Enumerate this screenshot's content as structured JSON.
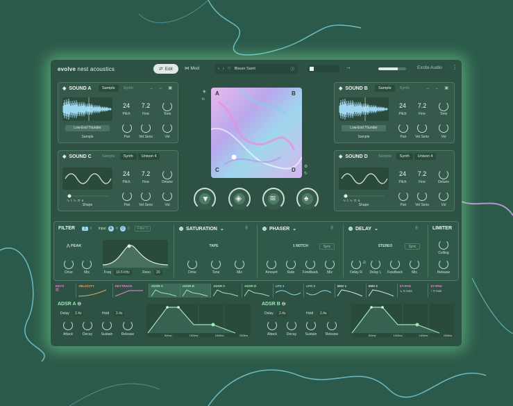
{
  "header": {
    "brand_bold": "evolve",
    "brand_rest": "nest acoustics",
    "edit_label": "Edit",
    "mod_label": "Mod",
    "preset_name": "Blauer Samt",
    "company": "Excite Audio"
  },
  "sound_a": {
    "title": "SOUND A",
    "tab1": "Sample",
    "tab2": "Synth",
    "pitch_value": "24",
    "fine_value": "7.2",
    "pitch_label": "Pitch",
    "fine_label": "Fine",
    "tone_label": "Tone",
    "sample_name": "Low-End Thunder",
    "sample_label": "Sample",
    "pan_label": "Pan",
    "velsens_label": "Vel Sens",
    "vol_label": "Vol"
  },
  "sound_b": {
    "title": "SOUND B",
    "tab1": "Sample",
    "tab2": "Synth",
    "pitch_value": "24",
    "fine_value": "7.2",
    "pitch_label": "Pitch",
    "fine_label": "Fine",
    "tone_label": "Tone",
    "sample_name": "Low-End Thunder",
    "sample_label": "Sample",
    "pan_label": "Pan",
    "velsens_label": "Vel Sens",
    "vol_label": "Vol"
  },
  "sound_c": {
    "title": "SOUND C",
    "tab1": "Sample",
    "tab2": "Synth",
    "unison_label": "Unison",
    "unison_value": "4",
    "pitch_value": "24",
    "fine_value": "7.2",
    "pitch_label": "Pitch",
    "fine_label": "Fine",
    "detune_label": "Detune",
    "shape_label": "Shape",
    "pan_label": "Pan",
    "velsens_label": "Vel Sens",
    "vol_label": "Vol"
  },
  "sound_d": {
    "title": "SOUND D",
    "tab1": "Sample",
    "tab2": "Synth",
    "unison_label": "Unison",
    "unison_value": "4",
    "pitch_value": "24",
    "fine_value": "7.2",
    "pitch_label": "Pitch",
    "fine_label": "Fine",
    "detune_label": "Detune",
    "shape_label": "Shape",
    "pan_label": "Pan",
    "velsens_label": "Vel Sens",
    "vol_label": "Vol"
  },
  "xy": {
    "a": "A",
    "b": "B",
    "c": "C",
    "d": "D"
  },
  "filter": {
    "title": "FILTER",
    "num1": "1",
    "num2": "II",
    "input_label": "Input",
    "in_a": "A",
    "in_b": "B",
    "in_c": "C",
    "in_d": "D",
    "filter_btn": "Filter II",
    "type": "PEAK",
    "drive": "Drive",
    "mix": "Mix",
    "freq": "Freq",
    "freq_value": "10.5 kHz",
    "reso": "Reso",
    "reso_value": "20"
  },
  "saturation": {
    "title": "SATURATION",
    "mode": "TAPE",
    "drive": "Drive",
    "tone": "Tone",
    "mix": "Mix"
  },
  "phaser": {
    "title": "PHASER",
    "mode": "1 NOTCH",
    "sync": "Sync",
    "amount": "Amount",
    "rate": "Rate",
    "feedback": "Feedback",
    "mix": "Mix"
  },
  "delay": {
    "title": "DELAY",
    "mode": "STEREO",
    "sync": "Sync",
    "delay_r": "Delay R",
    "delay_l": "Delay L",
    "feedback": "Feedback",
    "mix": "Mix"
  },
  "limiter": {
    "title": "LIMITER",
    "ceiling": "Ceiling",
    "release": "Release"
  },
  "modtabs": {
    "keys": "KEYS",
    "velocity": "VELOCITY",
    "keytrack": "KEYTRACK",
    "adsr_a": "ADSR A",
    "adsr_b": "ADSR B",
    "adsr_c": "ADSR C",
    "adsr_d": "ADSR D",
    "lfo1": "LFO 1",
    "lfo2": "LFO 2",
    "env1": "ENV 1",
    "env2": "ENV 2",
    "xy_pad1": "XY-PAD",
    "xy_pad1_sub": "X-Axis",
    "xy_pad2": "XY-PAD",
    "xy_pad2_sub": "Y-Axis"
  },
  "adsr_a": {
    "title": "ADSR A",
    "delay_label": "Delay",
    "delay_value": "2.4s",
    "hold_label": "Hold",
    "hold_value": "2.4s",
    "attack": "Attack",
    "decay": "Decay",
    "sustain": "Sustain",
    "release": "Release",
    "t1": "500ms",
    "t2": "1000ms",
    "t3": "1500ms",
    "t4": "2000ms"
  },
  "adsr_b": {
    "title": "ADSR B",
    "delay_label": "Delay",
    "delay_value": "2.4s",
    "hold_label": "Hold",
    "hold_value": "2.4s",
    "attack": "Attack",
    "decay": "Decay",
    "sustain": "Sustain",
    "release": "Release",
    "t1": "500ms",
    "t2": "1000ms",
    "t3": "1500ms",
    "t4": "2000ms"
  },
  "colors": {
    "background": "#2c5a4a",
    "panel": "#355a4b",
    "accent_green": "#9fe6b8",
    "accent_cyan": "#8ee0e8",
    "accent_pink": "#e98ad2"
  }
}
